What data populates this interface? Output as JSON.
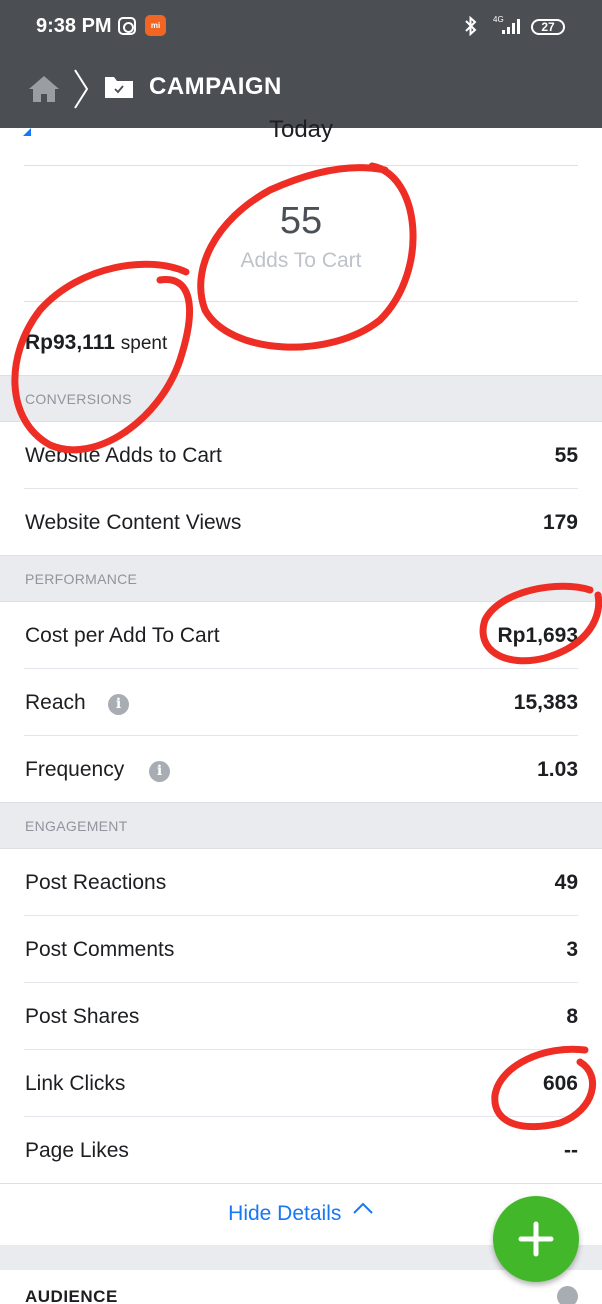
{
  "status_bar": {
    "time": "9:38 PM",
    "network_label": "4G",
    "battery": "27",
    "icons": [
      "instagram-icon",
      "mi-app-icon",
      "bluetooth-icon",
      "signal-icon",
      "battery-icon"
    ]
  },
  "nav": {
    "title": "CAMPAIGN",
    "icons": [
      "home-icon",
      "chevron-right-icon",
      "folder-icon"
    ]
  },
  "date_selector": {
    "label": "Today"
  },
  "headline_metric": {
    "value": "55",
    "label": "Adds To Cart"
  },
  "spend": {
    "amount": "Rp93,111",
    "suffix": "spent"
  },
  "sections": {
    "conversions": {
      "title": "CONVERSIONS",
      "rows": [
        {
          "label": "Website Adds to Cart",
          "value": "55"
        },
        {
          "label": "Website Content Views",
          "value": "179"
        }
      ]
    },
    "performance": {
      "title": "PERFORMANCE",
      "rows": [
        {
          "label": "Cost per Add To Cart",
          "value": "Rp1,693"
        },
        {
          "label": "Reach",
          "value": "15,383"
        },
        {
          "label": "Frequency",
          "value": "1.03"
        }
      ]
    },
    "engagement": {
      "title": "ENGAGEMENT",
      "rows": [
        {
          "label": "Post Reactions",
          "value": "49"
        },
        {
          "label": "Post Comments",
          "value": "3"
        },
        {
          "label": "Post Shares",
          "value": "8"
        },
        {
          "label": "Link Clicks",
          "value": "606"
        },
        {
          "label": "Page Likes",
          "value": "--"
        }
      ]
    }
  },
  "hide_details": {
    "label": "Hide Details"
  },
  "audience": {
    "title": "AUDIENCE"
  },
  "colors": {
    "header_bg": "#4b4e52",
    "section_bg": "#e9ebee",
    "link_blue": "#1877f2",
    "fab_green": "#42b72a",
    "annotation_red": "#ee2e24"
  }
}
